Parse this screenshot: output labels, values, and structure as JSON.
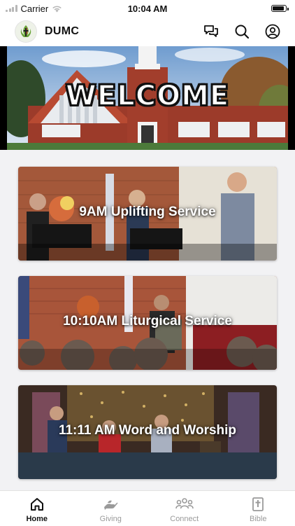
{
  "status": {
    "carrier": "Carrier",
    "time": "10:04 AM",
    "battery_level": 0.9
  },
  "header": {
    "title": "DUMC"
  },
  "hero": {
    "text": "WELCOME"
  },
  "services": [
    {
      "title": "9AM Uplifting Service"
    },
    {
      "title": "10:10AM Liturgical Service"
    },
    {
      "title": "11:11 AM Word and Worship"
    }
  ],
  "tabs": [
    {
      "label": "Home",
      "icon": "home-icon",
      "active": true
    },
    {
      "label": "Giving",
      "icon": "giving-hand-icon"
    },
    {
      "label": "Connect",
      "icon": "people-icon"
    },
    {
      "label": "Bible",
      "icon": "bible-icon"
    }
  ],
  "colors": {
    "accent": "#111111",
    "inactive": "#9a9a9a",
    "background": "#f2f2f4"
  }
}
